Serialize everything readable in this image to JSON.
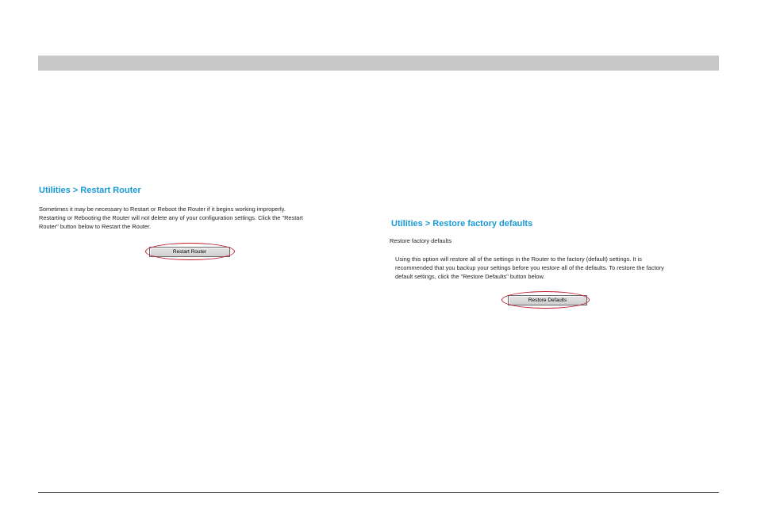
{
  "restart_section": {
    "title": "Utilities > Restart Router",
    "description_lines": [
      "Sometimes it may be necessary to Restart or Reboot the Router if it begins working improperly.",
      "Restarting or Rebooting the Router will not delete any of your configuration settings. Click the \"Restart",
      "Router\" button below to Restart the Router."
    ],
    "button_label": "Restart Router"
  },
  "restore_section": {
    "title": "Utilities > Restore factory defaults",
    "subtitle": "Restore factory defaults",
    "description_lines": [
      "Using this option will restore all of the settings in the Router to the factory (default) settings. It is",
      "recommended that you backup your settings before you restore all of the defaults. To restore the factory",
      "default settings, click the \"Restore Defaults\" button below."
    ],
    "button_label": "Restore Defaults"
  },
  "colors": {
    "title_blue": "#1a9ad6",
    "header_bar_gray": "#c8c8c8",
    "highlight_red": "#c01a28"
  }
}
